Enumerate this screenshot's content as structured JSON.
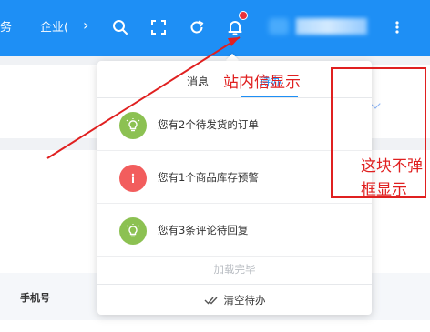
{
  "header": {
    "crumb_left": "务",
    "crumb_mid": "企业(",
    "chevron": "›",
    "icons": [
      "search-icon",
      "fullscreen-icon",
      "refresh-icon",
      "bell-icon",
      "more-vertical-icon"
    ]
  },
  "table": {
    "column_phone": "手机号"
  },
  "popup": {
    "tabs": [
      {
        "label": "消息",
        "active": false
      },
      {
        "label": "待办",
        "active": true
      }
    ],
    "items": [
      {
        "text": "您有2个待发货的订单",
        "icon": "lightbulb-icon",
        "color": "#8cc152"
      },
      {
        "text": "您有1个商品库存预警",
        "icon": "info-icon",
        "color": "#f25d5d"
      },
      {
        "text": "您有3条评论待回复",
        "icon": "lightbulb-icon",
        "color": "#8cc152"
      }
    ],
    "load_done": "加载完毕",
    "clear_label": "清空待办"
  },
  "annotations": {
    "note1": "站内信显示",
    "note2": "这块不弹框显示"
  },
  "colors": {
    "header_bg": "#1e8ff5",
    "accent": "#1e8ff5",
    "annotation": "#e02020"
  }
}
